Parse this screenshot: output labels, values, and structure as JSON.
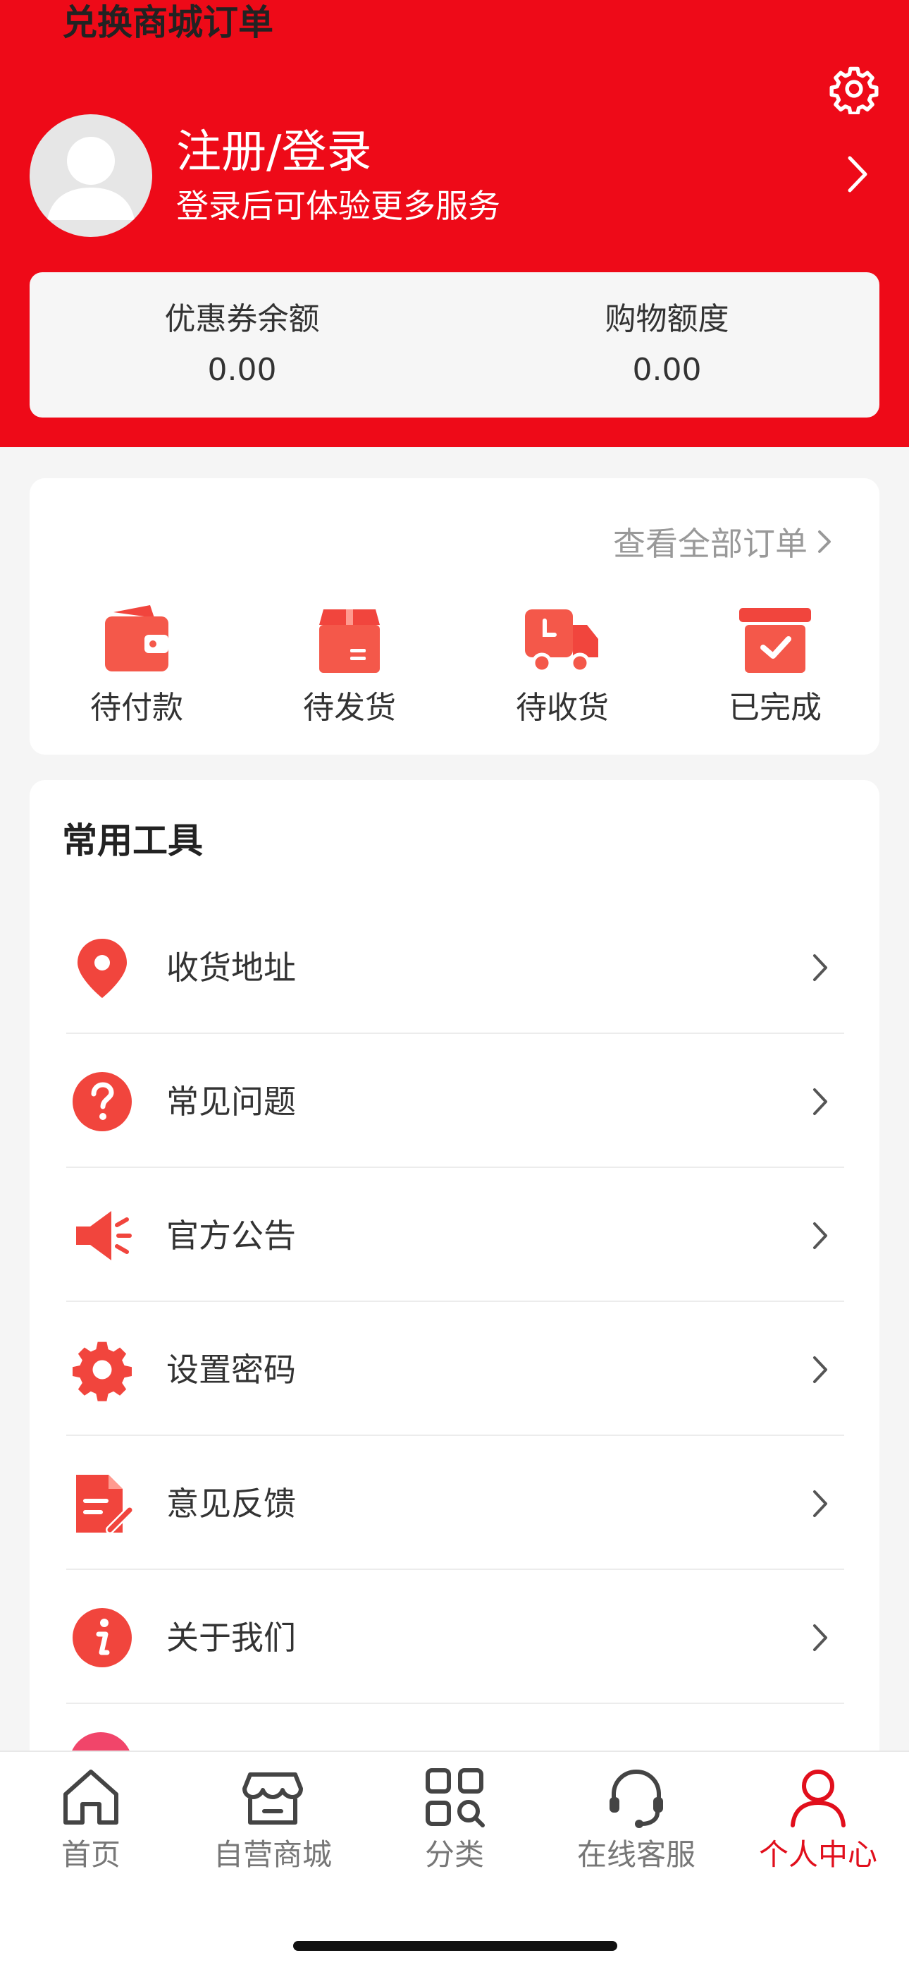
{
  "header": {
    "title": "注册/登录",
    "subtitle": "登录后可体验更多服务",
    "icons": {
      "settings": "gear-icon",
      "avatar": "avatar-icon",
      "chevron": "chevron-right-icon"
    }
  },
  "stats": [
    {
      "label": "优惠券余额",
      "value": "0.00"
    },
    {
      "label": "购物额度",
      "value": "0.00"
    }
  ],
  "orders": {
    "title": "兑换商城订单",
    "view_all": "查看全部订单",
    "items": [
      {
        "label": "待付款",
        "icon": "wallet-icon"
      },
      {
        "label": "待发货",
        "icon": "box-icon"
      },
      {
        "label": "待收货",
        "icon": "truck-icon"
      },
      {
        "label": "已完成",
        "icon": "archive-check-icon"
      }
    ]
  },
  "tools": {
    "title": "常用工具",
    "items": [
      {
        "label": "收货地址",
        "icon": "location-pin-icon"
      },
      {
        "label": "常见问题",
        "icon": "question-icon"
      },
      {
        "label": "官方公告",
        "icon": "megaphone-icon"
      },
      {
        "label": "设置密码",
        "icon": "gear-icon"
      },
      {
        "label": "意见反馈",
        "icon": "feedback-doc-icon"
      },
      {
        "label": "关于我们",
        "icon": "info-icon"
      }
    ]
  },
  "nav": {
    "items": [
      {
        "label": "首页",
        "icon": "home-icon"
      },
      {
        "label": "自营商城",
        "icon": "store-icon"
      },
      {
        "label": "分类",
        "icon": "category-icon"
      },
      {
        "label": "在线客服",
        "icon": "headset-icon"
      },
      {
        "label": "个人中心",
        "icon": "user-icon",
        "active": true
      }
    ]
  },
  "colors": {
    "brand_red": "#ee0a18",
    "icon_red": "#f1453d",
    "active_nav": "#e10f1c"
  }
}
